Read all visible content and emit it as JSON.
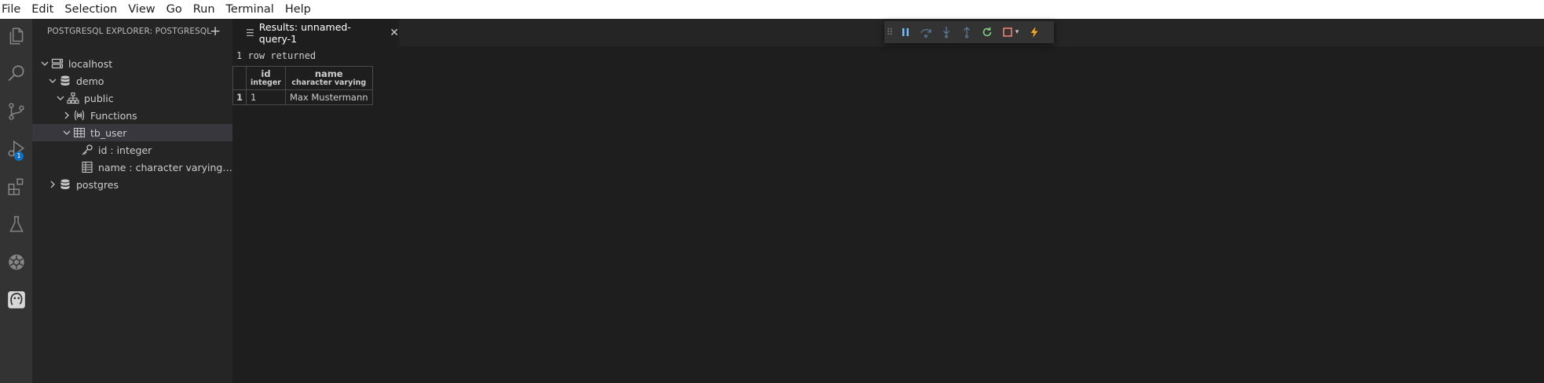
{
  "menu": [
    "File",
    "Edit",
    "Selection",
    "View",
    "Go",
    "Run",
    "Terminal",
    "Help"
  ],
  "activity": {
    "icons": [
      "files-icon",
      "search-icon",
      "source-control-icon",
      "run-debug-icon",
      "extensions-icon",
      "testing-icon",
      "kubernetes-icon",
      "postgresql-icon"
    ],
    "debug_badge": "1"
  },
  "sidebar": {
    "title": "POSTGRESQL EXPLORER: POSTGRESQL",
    "add_label": "+",
    "tree": [
      {
        "label": "localhost",
        "icon": "server-icon",
        "expanded": true
      },
      {
        "label": "demo",
        "icon": "database-icon",
        "expanded": true
      },
      {
        "label": "public",
        "icon": "schema-icon",
        "expanded": true
      },
      {
        "label": "Functions",
        "icon": "functions-icon",
        "expanded": false
      },
      {
        "label": "tb_user",
        "icon": "table-icon",
        "expanded": true,
        "selected": true
      },
      {
        "label": "id : integer",
        "icon": "key-icon"
      },
      {
        "label": "name : character varying…",
        "icon": "column-icon"
      },
      {
        "label": "postgres",
        "icon": "database-icon",
        "expanded": false
      }
    ]
  },
  "editor": {
    "tab": {
      "label": "Results: unnamed-query-1",
      "close": "✕"
    },
    "status": "1 row returned",
    "table": {
      "columns": [
        {
          "name": "id",
          "type": "integer"
        },
        {
          "name": "name",
          "type": "character varying"
        }
      ],
      "rows": [
        {
          "num": "1",
          "cells": [
            "1",
            "Max Mustermann"
          ]
        }
      ]
    }
  },
  "colors": {
    "accent": "#0e70c0",
    "continue": "#75beff",
    "restart": "#89d185",
    "stop": "#f48771",
    "hot_reload": "#f5a623"
  }
}
